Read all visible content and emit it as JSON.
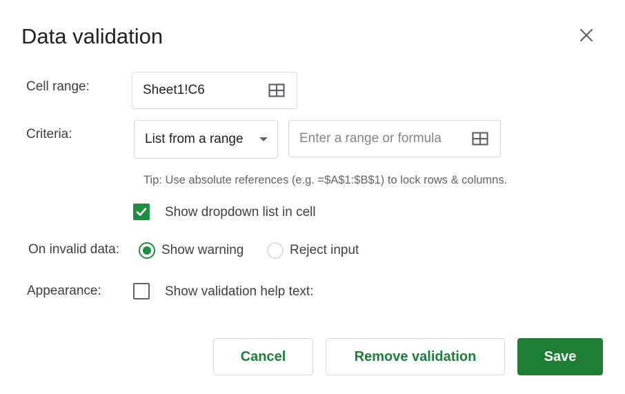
{
  "dialog": {
    "title": "Data validation"
  },
  "cell_range": {
    "label": "Cell range:",
    "value": "Sheet1!C6"
  },
  "criteria": {
    "label": "Criteria:",
    "selected": "List from a range",
    "range_placeholder": "Enter a range or formula",
    "tip": "Tip: Use absolute references (e.g. =$A$1:$B$1) to lock rows & columns.",
    "show_dropdown_label": "Show dropdown list in cell",
    "show_dropdown_checked": true
  },
  "invalid_data": {
    "label": "On invalid data:",
    "options": [
      {
        "label": "Show warning",
        "selected": true
      },
      {
        "label": "Reject input",
        "selected": false
      }
    ]
  },
  "appearance": {
    "label": "Appearance:",
    "help_text_label": "Show validation help text:",
    "help_text_checked": false
  },
  "buttons": {
    "cancel": "Cancel",
    "remove": "Remove validation",
    "save": "Save"
  },
  "colors": {
    "accent": "#1e8e3e",
    "primary_button": "#1e7e34",
    "button_text": "#188038"
  },
  "icons": {
    "close": "close-icon",
    "range_select": "grid-icon",
    "dropdown": "caret-down-icon",
    "check": "check-icon"
  }
}
